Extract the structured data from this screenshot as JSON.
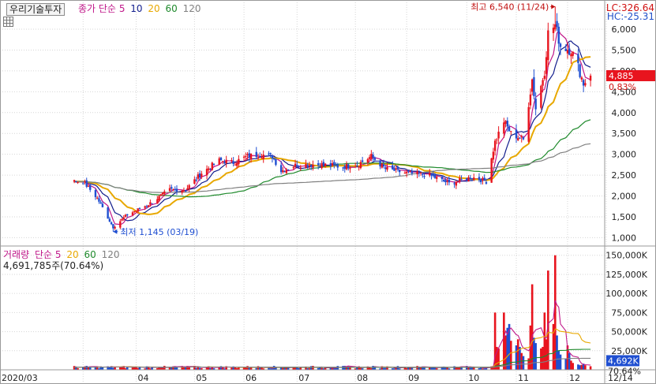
{
  "header": {
    "stock_name": "우리기술투자",
    "ma_label": "종가 단순",
    "ma_periods": [
      "5",
      "10",
      "20",
      "60",
      "120"
    ]
  },
  "price_info": {
    "lc": "LC:326.64",
    "hc": "HC:-25.31",
    "current_price": "4,885",
    "change_pct": "0.83%"
  },
  "annotations": {
    "high": "최고 6,540 (11/24)",
    "low": "최저 1,145 (03/19)"
  },
  "volume_header": {
    "label": "거래량",
    "ma_label": "단순",
    "ma_periods": [
      "5",
      "20",
      "60",
      "120"
    ],
    "current_volume": "4,691,785주(70.64%)",
    "current_volume_axis": "4,692K",
    "current_volume_pct": "70.64%"
  },
  "colors": {
    "up": "#e8141e",
    "down": "#1f4fd1",
    "ma5": "#c0188a",
    "ma10": "#101c8c",
    "ma20": "#e8a800",
    "ma60": "#1f8a2c",
    "ma120": "#808080"
  },
  "chart_data": [
    {
      "type": "candlestick",
      "title": "우리기술투자",
      "y_axis_ticks": [
        "1,000",
        "1,500",
        "2,000",
        "2,500",
        "3,000",
        "3,500",
        "4,000",
        "4,500",
        "5,000",
        "5,500",
        "6,000"
      ],
      "ylim": [
        800,
        6700
      ],
      "x_axis_labels": [
        "2020/03",
        "04",
        "05",
        "06",
        "07",
        "08",
        "09",
        "10",
        "11",
        "12",
        "12/14"
      ],
      "grid": true,
      "anchors": [
        [
          "2020-03-02",
          2350
        ],
        [
          "2020-03-10",
          1950
        ],
        [
          "2020-03-19",
          1250
        ],
        [
          "2020-03-27",
          1550
        ],
        [
          "2020-04-08",
          1800
        ],
        [
          "2020-04-20",
          2150
        ],
        [
          "2020-04-29",
          2150
        ],
        [
          "2020-05-08",
          2550
        ],
        [
          "2020-05-18",
          2850
        ],
        [
          "2020-05-26",
          2800
        ],
        [
          "2020-06-03",
          2950
        ],
        [
          "2020-06-10",
          3000
        ],
        [
          "2020-06-17",
          2950
        ],
        [
          "2020-06-22",
          2600
        ],
        [
          "2020-07-01",
          2750
        ],
        [
          "2020-07-15",
          2750
        ],
        [
          "2020-07-27",
          2700
        ],
        [
          "2020-08-04",
          2750
        ],
        [
          "2020-08-12",
          2950
        ],
        [
          "2020-08-20",
          2650
        ],
        [
          "2020-09-01",
          2550
        ],
        [
          "2020-09-14",
          2500
        ],
        [
          "2020-09-25",
          2300
        ],
        [
          "2020-10-08",
          2450
        ],
        [
          "2020-10-16",
          2350
        ],
        [
          "2020-10-21",
          3300
        ],
        [
          "2020-10-26",
          3800
        ],
        [
          "2020-10-30",
          3500
        ],
        [
          "2020-11-06",
          3350
        ],
        [
          "2020-11-11",
          4800
        ],
        [
          "2020-11-13",
          4100
        ],
        [
          "2020-11-18",
          5000
        ],
        [
          "2020-11-20",
          5900
        ],
        [
          "2020-11-24",
          6100
        ],
        [
          "2020-11-27",
          5600
        ],
        [
          "2020-12-03",
          5500
        ],
        [
          "2020-12-07",
          5100
        ],
        [
          "2020-12-10",
          4700
        ],
        [
          "2020-12-14",
          4885
        ]
      ],
      "high": {
        "date": "2020-11-24",
        "value": 6540
      },
      "low": {
        "date": "2020-03-19",
        "value": 1145
      },
      "last_close": 4885
    },
    {
      "type": "bar",
      "title": "거래량",
      "y_axis_ticks": [
        "25,000K",
        "50,000K",
        "75,000K",
        "100,000K",
        "125,000K",
        "150,000K"
      ],
      "ylim": [
        0,
        158000
      ],
      "spikes": [
        [
          "2020-10-21",
          75000
        ],
        [
          "2020-10-22",
          30000
        ],
        [
          "2020-10-23",
          28000
        ],
        [
          "2020-10-26",
          75000
        ],
        [
          "2020-10-27",
          45000
        ],
        [
          "2020-10-28",
          55000
        ],
        [
          "2020-10-29",
          60000
        ],
        [
          "2020-10-30",
          38000
        ],
        [
          "2020-11-02",
          32000
        ],
        [
          "2020-11-03",
          40000
        ],
        [
          "2020-11-04",
          30000
        ],
        [
          "2020-11-05",
          22000
        ],
        [
          "2020-11-06",
          18000
        ],
        [
          "2020-11-09",
          15000
        ],
        [
          "2020-11-10",
          58000
        ],
        [
          "2020-11-11",
          112000
        ],
        [
          "2020-11-12",
          42000
        ],
        [
          "2020-11-13",
          35000
        ],
        [
          "2020-11-16",
          28000
        ],
        [
          "2020-11-17",
          30000
        ],
        [
          "2020-11-18",
          75000
        ],
        [
          "2020-11-19",
          40000
        ],
        [
          "2020-11-20",
          130000
        ],
        [
          "2020-11-23",
          60000
        ],
        [
          "2020-11-24",
          150000
        ],
        [
          "2020-11-25",
          45000
        ],
        [
          "2020-11-26",
          25000
        ],
        [
          "2020-11-27",
          20000
        ],
        [
          "2020-11-30",
          15000
        ],
        [
          "2020-12-01",
          32000
        ],
        [
          "2020-12-02",
          22000
        ],
        [
          "2020-12-03",
          12000
        ],
        [
          "2020-12-04",
          9000
        ],
        [
          "2020-12-07",
          7000
        ],
        [
          "2020-12-08",
          6000
        ],
        [
          "2020-12-09",
          6500
        ],
        [
          "2020-12-10",
          8000
        ],
        [
          "2020-12-11",
          6000
        ],
        [
          "2020-12-14",
          4692
        ]
      ],
      "baseline_volume_k": 3500
    }
  ]
}
